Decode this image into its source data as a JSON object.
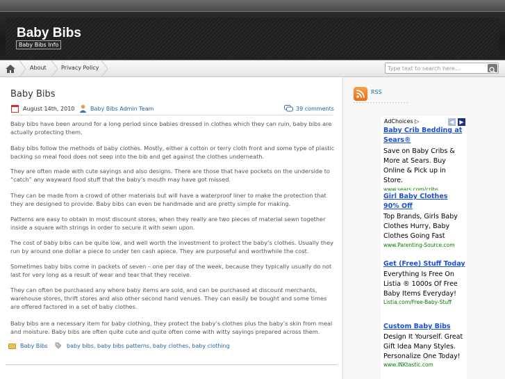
{
  "header": {
    "title": "Baby Bibs",
    "description": "Baby Bibs Info"
  },
  "nav": {
    "items": [
      "About",
      "Privacy Policy"
    ]
  },
  "search": {
    "placeholder": "Type text to search here..."
  },
  "post": {
    "title": "Baby Bibs",
    "date": "August 14th, 2010",
    "author": "Baby Bibs Admin Team",
    "comments": "39 comments",
    "paragraphs": [
      "Baby bibs have been around for a long period since babies dressed in clothes which they can ruin, baby bibs are actually protecting them.",
      "Baby bibs follow the methods of baby clothes. Mostly, either a cotton or terry cloth front and some type of plastic backing so meal food does not seep into the bib and get against the clothes underneath.",
      "They are often made with cute sayings and also designs. There are those that have pockets on the underside to “catch” any wayward food stuff that the baby’s mouth may have got missed.",
      "They can be made from a crowd of other materials but will have a waterproof liner to make the protection that they are designed to provide. Baby bibs can even be handmade and are pretty simple for making.",
      "Patterns are easy to obtain in most discount stores, when they really are two pieces of material sewn together inside a square with strings in order to secure it with sewn upon.",
      "The cost of baby bibs can be quite low, and well worth the investment to protect the baby’s clothes. Usually they run by around one dollar a piece to under ten cash apiece. They are purposeful and worthwhile the cost.",
      "Sometimes baby bibs come in packets of seven – one per day of the week, because they typically usually do not last for very long as a result of wear and tear that they receive.",
      "They can often be purchased any where baby items are sold, and can be purchased at discount merchants, warehouse stores, thrift stores and also other second hand venues. They can easily be bought and some times are offered factored in a set of baby clothes.",
      "Baby bibs are a necessary item for baby clothing, they protect the baby’s clothes plus the baby’s skin from meal and moisture. Baby bibs are often quite cute and quite often come with witty sayings prepared across them."
    ],
    "category": "Baby Bibs",
    "tags": "baby bibs, baby bibs patterns, baby clothes, baby clothing"
  },
  "sidebar": {
    "rss": "RSS",
    "adchoices": "AdChoices",
    "ads": [
      {
        "title": "Baby Crib Bedding at Sears®",
        "body": "Save on Baby Cribs & More at Sears. Buy Online & Pick up in Store.",
        "url": "www.sears.com/cribs"
      },
      {
        "title": "Girl Baby Clothes 90% Off",
        "body": "Top Brands, Girls Baby Clothes Hurry, Baby Clothes Going Fast",
        "url": "www.Parenting-Source.com"
      },
      {
        "title": "Get (Free) Stuff Today",
        "body": "Everything Is Free On Listia ® 1000s Of Free Baby Items Everyday!",
        "url": "Listia.com/Free-Baby-Stuff"
      },
      {
        "title": "Custom Baby Bibs",
        "body": "Design It Yourself. Great Gift Idea Many Styles. Personalize One Today!",
        "url": "www.INKtastic.com"
      }
    ]
  }
}
